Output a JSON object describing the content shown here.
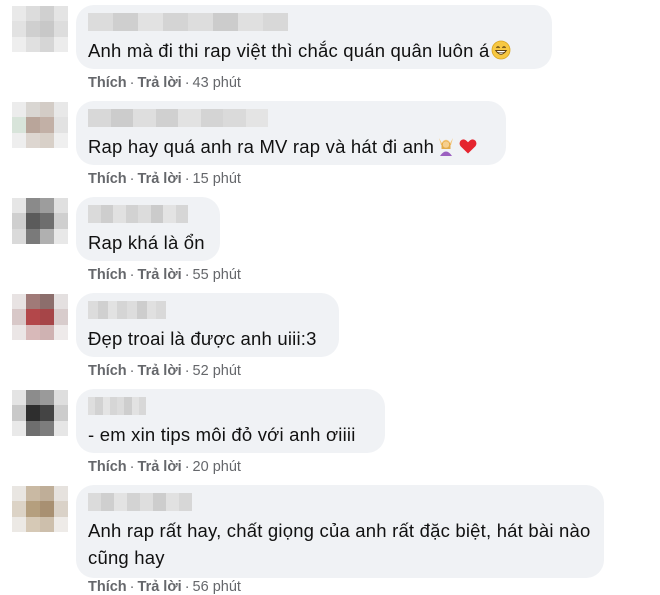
{
  "comments": [
    {
      "text": "Anh mà đi thi rap việt thì chắc quán quân luôn á",
      "emoji": "grinning-face-with-smiling-eyes",
      "like": "Thích",
      "reply": "Trả lời",
      "time": "43 phút"
    },
    {
      "text": "Rap hay quá anh ra MV rap và hát đi anh",
      "emoji": "person-raising-hands-and-red-heart",
      "like": "Thích",
      "reply": "Trả lời",
      "time": "15 phút"
    },
    {
      "text": "Rap khá là ổn",
      "like": "Thích",
      "reply": "Trả lời",
      "time": "55 phút"
    },
    {
      "text": "Đẹp troai là được anh uiii:3",
      "like": "Thích",
      "reply": "Trả lời",
      "time": "52 phút"
    },
    {
      "text": "- em xin tips môi đỏ với anh ơiiii",
      "like": "Thích",
      "reply": "Trả lời",
      "time": "20 phút"
    },
    {
      "text": "Anh rap rất hay, chất giọng của anh rất đặc biệt, hát bài nào cũng hay",
      "like": "Thích",
      "reply": "Trả lời",
      "time": "56 phút"
    }
  ],
  "colors": {
    "bubble": "#f0f2f5",
    "meta_text": "#65676b",
    "comment_text": "#111111"
  }
}
